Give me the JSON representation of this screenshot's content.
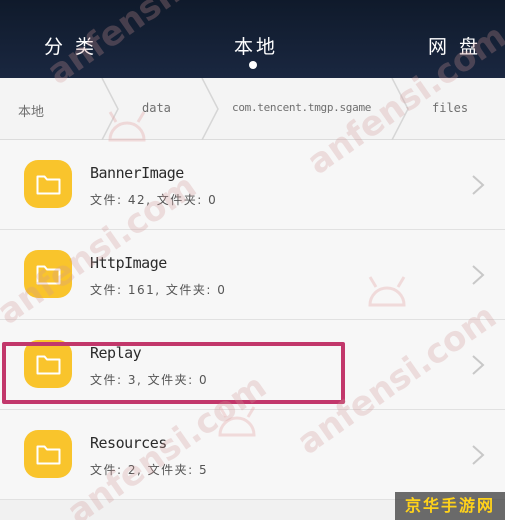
{
  "tabs": [
    {
      "label": "分 类"
    },
    {
      "label": "本地"
    },
    {
      "label": "网 盘"
    }
  ],
  "breadcrumb": [
    "本地",
    "data",
    "com.tencent.tmgp.sgame",
    "files"
  ],
  "folders": [
    {
      "name": "BannerImage",
      "info": "文件: 42, 文件夹: 0"
    },
    {
      "name": "HttpImage",
      "info": "文件: 161, 文件夹: 0"
    },
    {
      "name": "Replay",
      "info": "文件: 3, 文件夹: 0"
    },
    {
      "name": "Resources",
      "info": "文件: 2, 文件夹: 5"
    }
  ],
  "watermark": "anfensi.com",
  "corner_badge": "京华手游网",
  "colors": {
    "topbar": "#15203a",
    "folder": "#f9c42c",
    "highlight": "#c2376b",
    "badge_text": "#ffd21a"
  }
}
